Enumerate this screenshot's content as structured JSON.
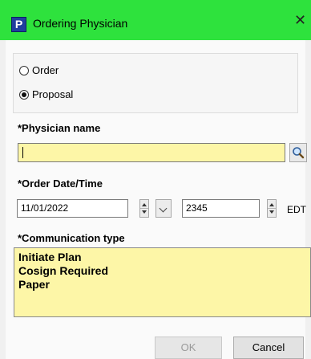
{
  "window": {
    "title": "Ordering Physician",
    "app_icon_letter": "P",
    "close_glyph": "✕"
  },
  "order_type": {
    "options": [
      {
        "label": "Order",
        "checked": false
      },
      {
        "label": "Proposal",
        "checked": true
      }
    ]
  },
  "physician": {
    "label": "*Physician name",
    "value": "",
    "search_icon": "magnifier-icon"
  },
  "order_datetime": {
    "label": "*Order Date/Time",
    "date": "11/01/2022",
    "time": "2345",
    "timezone": "EDT"
  },
  "communication": {
    "label": "*Communication type",
    "items": [
      "Initiate Plan",
      "Cosign Required",
      "Paper"
    ]
  },
  "buttons": {
    "ok": "OK",
    "cancel": "Cancel"
  },
  "colors": {
    "titlebar": "#2ee23d",
    "required_field": "#fdf6a7"
  }
}
